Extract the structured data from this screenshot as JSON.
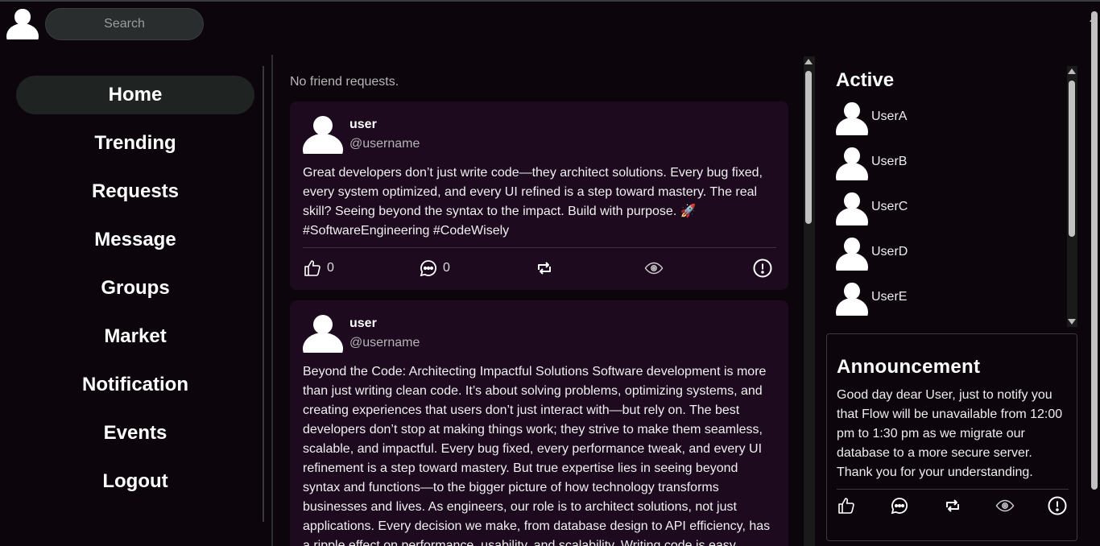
{
  "search": {
    "placeholder": "Search"
  },
  "sidebar": {
    "items": [
      {
        "label": "Home",
        "active": true
      },
      {
        "label": "Trending"
      },
      {
        "label": "Requests"
      },
      {
        "label": "Message"
      },
      {
        "label": "Groups"
      },
      {
        "label": "Market"
      },
      {
        "label": "Notification"
      },
      {
        "label": "Events"
      },
      {
        "label": "Logout"
      }
    ]
  },
  "feed": {
    "no_requests": "No friend requests.",
    "posts": [
      {
        "name": "user",
        "handle": "@username",
        "body": "Great developers don’t just write code—they architect solutions. Every bug fixed, every system optimized, and every UI refined is a step toward mastery. The real skill? Seeing beyond the syntax to the impact. Build with purpose. 🚀 #SoftwareEngineering #CodeWisely",
        "likes": "0",
        "comments": "0"
      },
      {
        "name": "user",
        "handle": "@username",
        "body": "Beyond the Code: Architecting Impactful Solutions Software development is more than just writing clean code. It’s about solving problems, optimizing systems, and creating experiences that users don’t just interact with—but rely on. The best developers don’t stop at making things work; they strive to make them seamless, scalable, and impactful. Every bug fixed, every performance tweak, and every UI refinement is a step toward mastery. But true expertise lies in seeing beyond syntax and functions—to the bigger picture of how technology transforms businesses and lives. As engineers, our role is to architect solutions, not just applications. Every decision we make, from database design to API efficiency, has a ripple effect on performance, usability, and scalability. Writing code is easy..."
      }
    ]
  },
  "active": {
    "title": "Active",
    "users": [
      "UserA",
      "UserB",
      "UserC",
      "UserD",
      "UserE"
    ]
  },
  "announcement": {
    "title": "Announcement",
    "body": "Good day dear User, just to notify you that Flow will be unavailable from 12:00 pm to 1:30 pm as we migrate our database to a more secure server. Thank you for your understanding."
  },
  "icons": {
    "like": "thumbs-up-icon",
    "comment": "comment-icon",
    "repost": "repost-icon",
    "view": "eye-icon",
    "report": "alert-circle-icon"
  }
}
